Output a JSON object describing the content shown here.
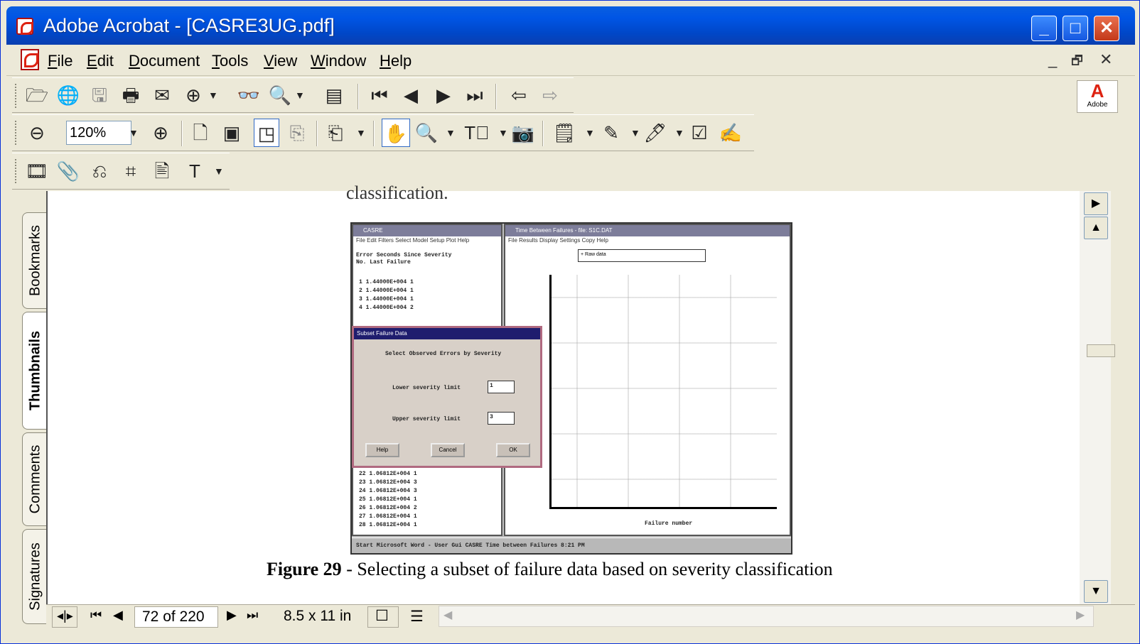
{
  "window": {
    "title": "Adobe Acrobat - [CASRE3UG.pdf]",
    "min": "_",
    "max": "□",
    "close": "✕"
  },
  "menu": {
    "items": [
      {
        "key": "F",
        "rest": "ile"
      },
      {
        "key": "E",
        "rest": "dit"
      },
      {
        "key": "D",
        "rest": "ocument"
      },
      {
        "key": "T",
        "rest": "ools"
      },
      {
        "key": "V",
        "rest": "iew"
      },
      {
        "key": "W",
        "rest": "indow"
      },
      {
        "key": "H",
        "rest": "elp"
      }
    ],
    "mdi": {
      "min": "_",
      "restore": "🗗",
      "close": "✕"
    }
  },
  "toolbar": {
    "zoom_value": "120%"
  },
  "adobe_logo": {
    "text": "Adobe"
  },
  "nav_tabs": [
    "Bookmarks",
    "Thumbnails",
    "Comments",
    "Signatures"
  ],
  "document": {
    "cut_text": "classification.",
    "caption_bold": "Figure 29",
    "caption_rest": " - Selecting a subset of failure data based on severity classification",
    "figure": {
      "left_title": "CASRE",
      "left_menu": "File  Edit  Filters  Select Model  Setup  Plot  Help",
      "header": "Error   Seconds Since   Severity",
      "header2": "No.     Last Failure",
      "rows_top": [
        "1    1.44000E+004   1",
        "2    1.44000E+004   1",
        "3    1.44000E+004   1",
        "4    1.44000E+004   2"
      ],
      "rows_bottom": [
        "22   1.06812E+004   1",
        "23   1.06812E+004   3",
        "24   1.06812E+004   3",
        "25   1.06812E+004   1",
        "26   1.06812E+004   2",
        "27   1.06812E+004   1",
        "28   1.06812E+004   1"
      ],
      "dialog_title": "Subset Failure Data",
      "dialog_heading": "Select Observed Errors by Severity",
      "lower_label": "Lower severity limit",
      "lower_value": "1",
      "upper_label": "Upper severity limit",
      "upper_value": "3",
      "help_btn": "Help",
      "cancel_btn": "Cancel",
      "ok_btn": "OK",
      "right_title": "Time Between Failures - file: S1C.DAT",
      "right_menu": "File  Results  Display  Settings  Copy  Help",
      "legend": "+ Raw data",
      "xlabel": "Failure number",
      "taskbar": "Start   Microsoft Word - User Gui   CASRE   Time between Failures  8:21 PM"
    }
  },
  "status": {
    "page": "72 of 220",
    "size": "8.5 x 11 in"
  }
}
